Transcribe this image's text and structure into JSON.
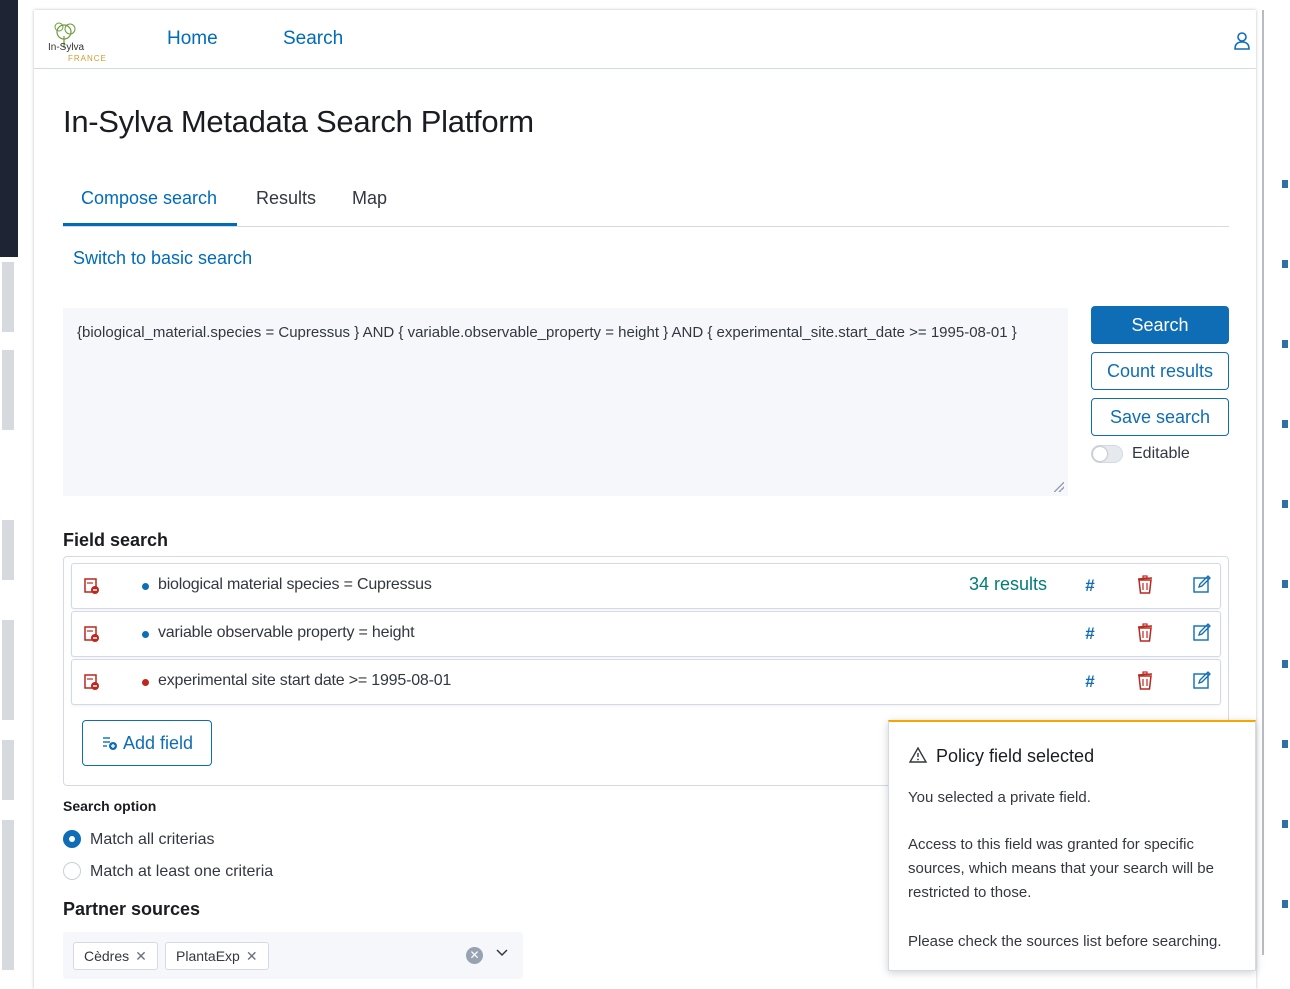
{
  "nav": {
    "logo_text": "In-Sylva",
    "logo_sub": "FRANCE",
    "home": "Home",
    "search": "Search"
  },
  "page_title": "In-Sylva Metadata Search Platform",
  "tabs": [
    "Compose search",
    "Results",
    "Map"
  ],
  "switch_link": "Switch to basic search",
  "query_text": "{biological_material.species = Cupressus } AND { variable.observable_property =  height } AND { experimental_site.start_date >= 1995-08-01 }",
  "actions": {
    "search": "Search",
    "count": "Count results",
    "save": "Save search",
    "editable": "Editable"
  },
  "field_search": {
    "heading": "Field search",
    "rows": [
      {
        "text": "biological material species = Cupressus",
        "results": "34 results",
        "dot": "#0f6db5"
      },
      {
        "text": "variable observable property = height",
        "results": "",
        "dot": "#0f6db5"
      },
      {
        "text": "experimental site start date >= 1995-08-01",
        "results": "",
        "dot": "#bd271e"
      }
    ],
    "hash": "#",
    "add_field": "Add field"
  },
  "search_option": {
    "heading": "Search option",
    "options": [
      "Match all criterias",
      "Match at least one criteria"
    ],
    "selected": 0
  },
  "partner_sources": {
    "heading": "Partner sources",
    "chips": [
      "Cèdres",
      "PlantaExp"
    ]
  },
  "toast": {
    "title": "Policy field selected",
    "line1": "You selected a private field.",
    "line2": "Access to this field was granted for specific sources, which means that your search will be restricted to those.",
    "line3": "Please check the sources list before searching."
  },
  "colors": {
    "accent": "#0f6db5",
    "success": "#017d73",
    "danger": "#bd271e",
    "warning": "#f5a700"
  }
}
